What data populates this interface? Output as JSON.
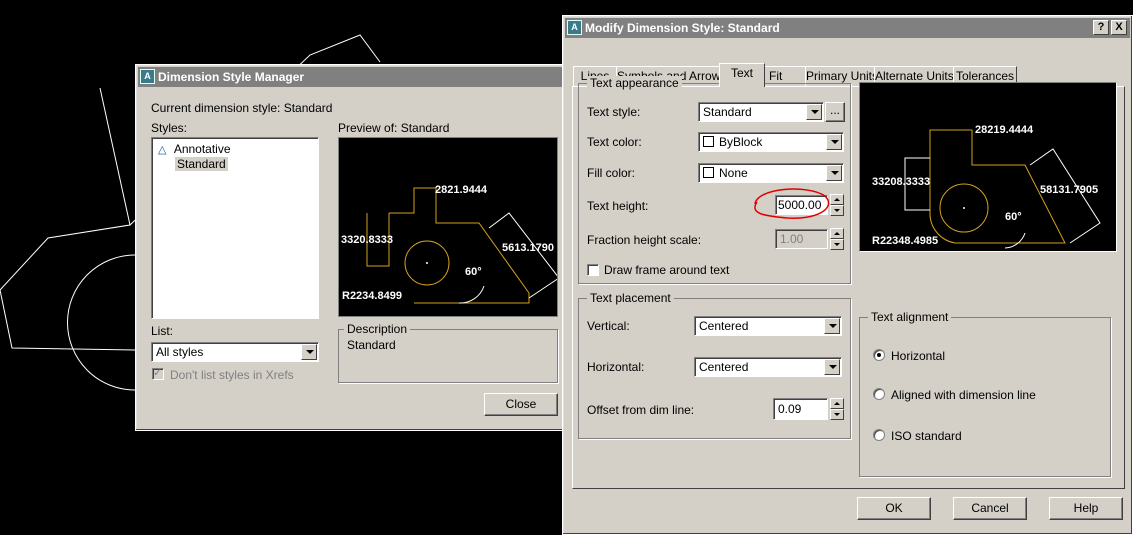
{
  "manager": {
    "title": "Dimension Style Manager",
    "current_style": "Current dimension style: Standard",
    "styles_label": "Styles:",
    "styles": [
      "Annotative",
      "Standard"
    ],
    "preview_label": "Preview of: Standard",
    "preview": {
      "top_dim": "2821.9444",
      "left_dim": "3320.8333",
      "right_dim": "5613.1790",
      "angle": "60°",
      "radius": "R2234.8499"
    },
    "list_label": "List:",
    "list_value": "All styles",
    "xref_checkbox": "Don't list styles in Xrefs",
    "description_title": "Description",
    "description_text": "Standard",
    "close_button": "Close"
  },
  "modify": {
    "title": "Modify Dimension Style: Standard",
    "help_icon": "?",
    "close_icon": "X",
    "tabs": [
      "Lines",
      "Symbols and Arrows",
      "Text",
      "Fit",
      "Primary Units",
      "Alternate Units",
      "Tolerances"
    ],
    "active_tab": "Text",
    "appearance": {
      "title": "Text appearance",
      "text_style_label": "Text style:",
      "text_style_value": "Standard",
      "browse_button": "...",
      "text_color_label": "Text color:",
      "text_color_value": "ByBlock",
      "fill_color_label": "Fill color:",
      "fill_color_value": "None",
      "text_height_label": "Text height:",
      "text_height_value": "5000.00",
      "fraction_label": "Fraction height scale:",
      "fraction_value": "1.00",
      "frame_label": "Draw frame around text"
    },
    "placement": {
      "title": "Text placement",
      "vertical_label": "Vertical:",
      "vertical_value": "Centered",
      "horizontal_label": "Horizontal:",
      "horizontal_value": "Centered",
      "offset_label": "Offset from dim line:",
      "offset_value": "0.09"
    },
    "alignment": {
      "title": "Text alignment",
      "options": [
        "Horizontal",
        "Aligned with dimension line",
        "ISO standard"
      ],
      "selected": "Horizontal"
    },
    "preview": {
      "top_dim": "28219.4444",
      "left_dim": "33208.3333",
      "right_dim": "58131.7905",
      "angle": "60°",
      "radius": "R22348.4985"
    },
    "buttons": {
      "ok": "OK",
      "cancel": "Cancel",
      "help": "Help"
    }
  },
  "colors": {
    "title_bar": "#808080",
    "dialog_bg": "#d4d0c8",
    "preview_line": "#d4a020",
    "highlight": "#e00000",
    "background": "#000000"
  }
}
